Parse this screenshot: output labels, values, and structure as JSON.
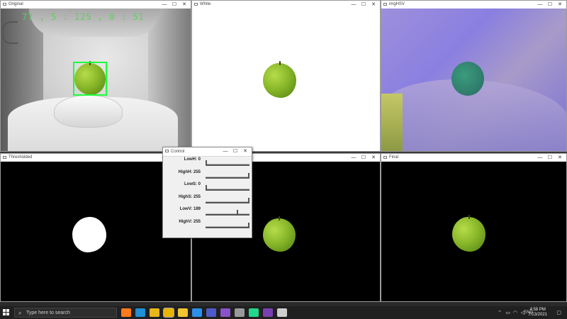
{
  "windows": {
    "original": {
      "title": "Original",
      "overlay_text": "77 , 5 : 125 , 8 : 51"
    },
    "white": {
      "title": "White"
    },
    "hsv": {
      "title": "imgHSV"
    },
    "thresholded": {
      "title": "Thresholded"
    },
    "final": {
      "title": "Final"
    }
  },
  "control": {
    "title": "Control",
    "sliders": [
      {
        "label": "LowH: 0",
        "value": 0,
        "max": 179
      },
      {
        "label": "HighH: 255",
        "value": 255,
        "max": 255
      },
      {
        "label": "LowS: 0",
        "value": 0,
        "max": 255
      },
      {
        "label": "HighS: 255",
        "value": 255,
        "max": 255
      },
      {
        "label": "LowV: 189",
        "value": 189,
        "max": 255
      },
      {
        "label": "HighV: 255",
        "value": 255,
        "max": 255
      }
    ]
  },
  "title_controls": {
    "minimize": "—",
    "maximize": "☐",
    "close": "✕"
  },
  "taskbar": {
    "search_placeholder": "Type here to search",
    "language": "ENG",
    "time": "4:58 PM",
    "date": "7/13/2021",
    "apps": [
      {
        "name": "firefox",
        "color": "#ff7a1a"
      },
      {
        "name": "edge",
        "color": "#1f8fd6"
      },
      {
        "name": "chrome",
        "color": "#e8b81a"
      },
      {
        "name": "chat-app",
        "color": "#e7b400"
      },
      {
        "name": "file-explorer",
        "color": "#f2c531"
      },
      {
        "name": "vscode",
        "color": "#2b8fe8"
      },
      {
        "name": "teams",
        "color": "#5059c9"
      },
      {
        "name": "visual-studio",
        "color": "#8a52c9"
      },
      {
        "name": "github-desktop",
        "color": "#9a9a9a"
      },
      {
        "name": "pycharm",
        "color": "#21d789"
      },
      {
        "name": "onenote",
        "color": "#7a3fb0"
      },
      {
        "name": "terminal-window",
        "color": "#cfcfcf"
      }
    ]
  },
  "colors": {
    "detection_box": "#1dff3a",
    "overlay_text": "#58d35a",
    "taskbar": "#202020"
  }
}
